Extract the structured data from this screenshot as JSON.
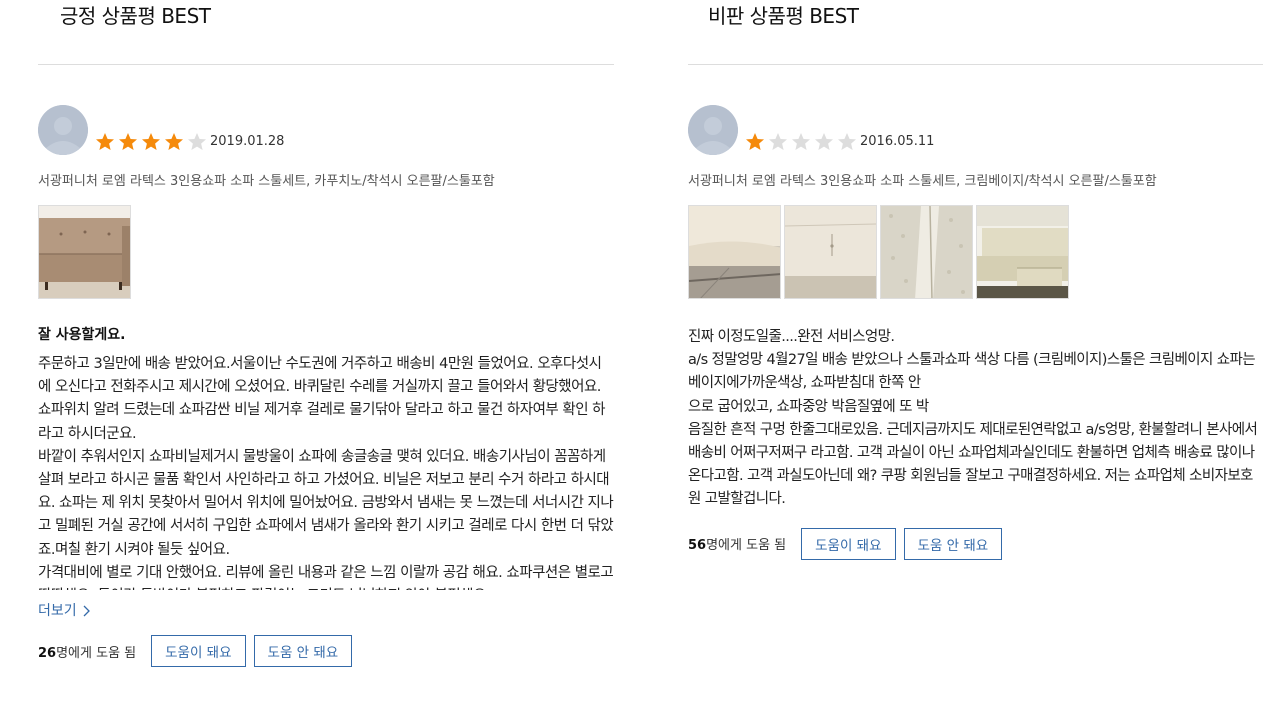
{
  "positive": {
    "section_title": "긍정 상품평 BEST",
    "rating": 4,
    "date": "2019.01.28",
    "product_option": "서광퍼니처 로엠 라텍스 3인용쇼파 소파 스툴세트, 카푸치노/착석시 오른팔/스툴포함",
    "headline": "잘 사용할게요.",
    "body": "주문하고 3일만에 배송 받았어요.서울이난 수도권에 거주하고 배송비 4만원 들었어요. 오후다섯시에 오신다고 전화주시고 제시간에 오셨어요. 바퀴달린 수레를 거실까지 끌고 들어와서 황당했어요. 쇼파위치 알려 드렸는데 쇼파감싼 비닐 제거후 걸레로 물기닦아 달라고 하고 물건 하자여부 확인 하라고 하시더군요.\n바깥이 추워서인지 쇼파비닐제거시 물방울이 쇼파에 송글송글 맺혀 있더요. 배송기사님이 꼼꼼하게 살펴 보라고 하시곤 물품 확인서 사인하라고 하고 가셨어요. 비닐은 저보고 분리 수거 하라고 하시대요. 쇼파는 제 위치 못찾아서 밀어서 위치에 밀어놨어요. 금방와서 냄새는 못 느꼈는데 서너시간 지나고 밀폐된 거실 공간에 서서히 구입한 쇼파에서 냄새가 올라와 환기 시키고 걸레로 다시 한번 더 닦았죠.며칠 환기 시켜야 될듯 싶어요.\n가격대비에 별로 기대 안했어요. 리뷰에 올린 내용과 같은 느낌 이랄까 공감 해요. 쇼파쿠션은 별로고 딱딱해요. 등이랑 등받이가 불편하고 팔걸이는 크기도 넉넉하지 않아 불편해요.",
    "more_label": "더보기",
    "helpful_count": "26",
    "helpful_suffix": "명에게 도움 됨",
    "helpful_yes": "도움이 돼요",
    "helpful_no": "도움 안 돼요"
  },
  "negative": {
    "section_title": "비판 상품평 BEST",
    "rating": 1,
    "date": "2016.05.11",
    "product_option": "서광퍼니처 로엠 라텍스 3인용쇼파 소파 스툴세트, 크림베이지/착석시 오른팔/스툴포함",
    "body": "진짜 이정도일줄....완전 서비스엉망.\na/s 정말엉망 4월27일 배송 받았으나 스툴과쇼파 색상 다름 (크림베이지)스툴은 크림베이지 쇼파는 베이지에가까운색상, 쇼파받침대 한쪽 안\n으로 굽어있고, 쇼파중앙 박음질옆에 또 박\n음질한 흔적 구멍 한줄그대로있음. 근데지금까지도 제대로된연락없고 a/s엉망, 환불할려니 본사에서 배송비 어쩌구저쩌구 라고함. 고객 과실이 아닌 쇼파업체과실인데도 환불하면 업체측 배송료 많이나온다고함. 고객 과실도아닌데 왜? 쿠팡 회원님들 잘보고 구매결정하세요. 저는 쇼파업체 소비자보호원 고발할겁니다.",
    "helpful_count": "56",
    "helpful_suffix": "명에게 도움 됨",
    "helpful_yes": "도움이 돼요",
    "helpful_no": "도움 안 돼요"
  },
  "colors": {
    "star_filled": "#f58a0b",
    "star_empty": "#dddddd",
    "link_blue": "#346aa9",
    "avatar": "#b6c0cf"
  },
  "icons": {
    "star": "star-icon",
    "chevron": "chevron-right-icon",
    "avatar": "user-avatar-icon"
  }
}
